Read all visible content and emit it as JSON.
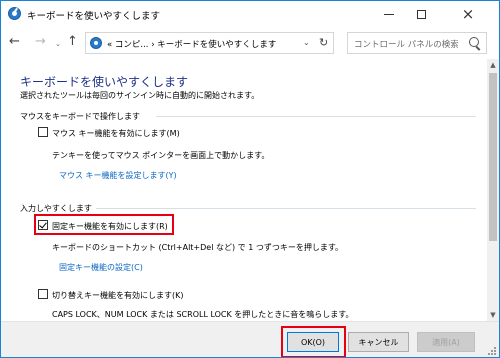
{
  "window": {
    "title": "キーボードを使いやすくします",
    "min_glyph": "",
    "close_glyph": "×"
  },
  "nav": {
    "back_glyph": "←",
    "forward_glyph": "→",
    "recent_glyph": "⌄",
    "up_glyph": "↑",
    "address": "« コンピ... › キーボードを使いやすくします",
    "address_dropdown_glyph": "⌄",
    "refresh_glyph": "↻",
    "search_placeholder": "コントロール パネルの検索"
  },
  "content": {
    "page_title": "キーボードを使いやすくします",
    "page_desc": "選択されたツールは毎回のサインイン時に自動的に開始されます。",
    "section_mouse": {
      "heading": "マウスをキーボードで操作します",
      "mouse_keys_label": "マウス キー機能を有効にします(M)",
      "mouse_keys_checked": false,
      "mouse_keys_desc": "テンキーを使ってマウス ポインターを画面上で動かします。",
      "mouse_keys_link": "マウス キー機能を設定します(Y)"
    },
    "section_typing": {
      "heading": "入力しやすくします",
      "sticky_keys_label": "固定キー機能を有効にします(R)",
      "sticky_keys_checked": true,
      "sticky_keys_desc": "キーボードのショートカット (Ctrl+Alt+Del など) で 1 つずつキーを押します。",
      "sticky_keys_link": "固定キー機能の設定(C)",
      "toggle_keys_label": "切り替えキー機能を有効にします(K)",
      "toggle_keys_checked": false,
      "toggle_keys_desc": "CAPS LOCK、NUM LOCK または SCROLL LOCK を押したときに音を鳴らします。"
    }
  },
  "scrollbar": {
    "up_glyph": "▲",
    "down_glyph": "▼"
  },
  "footer": {
    "ok_label": "OK(O)",
    "cancel_label": "キャンセル",
    "apply_label": "適用(A)"
  },
  "colors": {
    "heading_blue": "#1e3287",
    "link_blue": "#0a66c2",
    "highlight_red": "#e60012",
    "window_border": "#1883d7"
  }
}
